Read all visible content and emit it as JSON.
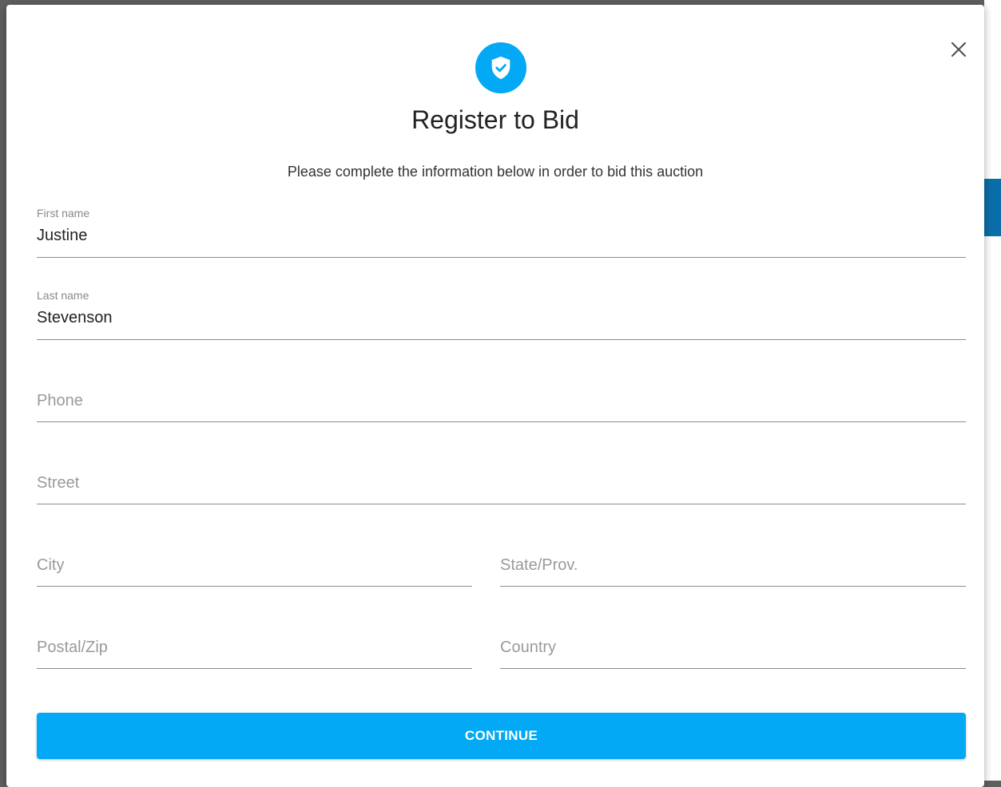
{
  "modal": {
    "title": "Register to Bid",
    "subtitle": "Please complete the information below in order to bid this auction"
  },
  "form": {
    "first_name": {
      "label": "First name",
      "value": "Justine"
    },
    "last_name": {
      "label": "Last name",
      "value": "Stevenson"
    },
    "phone": {
      "placeholder": "Phone"
    },
    "street": {
      "placeholder": "Street"
    },
    "city": {
      "placeholder": "City"
    },
    "state": {
      "placeholder": "State/Prov."
    },
    "postal": {
      "placeholder": "Postal/Zip"
    },
    "country": {
      "placeholder": "Country"
    }
  },
  "actions": {
    "continue_label": "CONTINUE"
  },
  "colors": {
    "accent": "#03a9f4",
    "backdrop": "#5f5f5f"
  },
  "icons": {
    "header": "shield-check-icon",
    "close": "close-icon"
  }
}
